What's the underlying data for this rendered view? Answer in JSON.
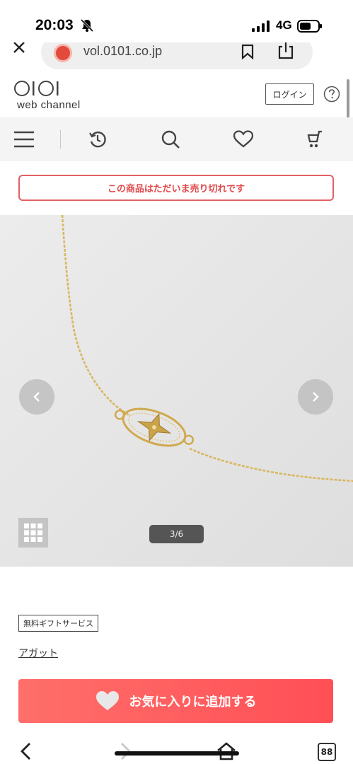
{
  "status_bar": {
    "time": "20:03",
    "network": "4G"
  },
  "browser": {
    "url": "vol.0101.co.jp"
  },
  "header": {
    "logo_text": "OIOI",
    "logo_sub": "web channel",
    "login_label": "ログイン"
  },
  "nav": {
    "items": [
      "menu",
      "history",
      "search",
      "favorites",
      "cart"
    ]
  },
  "notice": {
    "sold_out": "この商品はただいま売り切れです"
  },
  "gallery": {
    "counter": "3/6",
    "current_image": 3,
    "total_images": 6
  },
  "product": {
    "gift_service": "無料ギフトサービス",
    "brand": "アガット"
  },
  "actions": {
    "add_favorite": "お気に入りに追加する"
  },
  "bottom_bar": {
    "tabs_count": "88"
  },
  "colors": {
    "soldout_red": "#e0494b",
    "favorite_button": "#ff5a5f",
    "gold_chain": "#d4b25c"
  }
}
